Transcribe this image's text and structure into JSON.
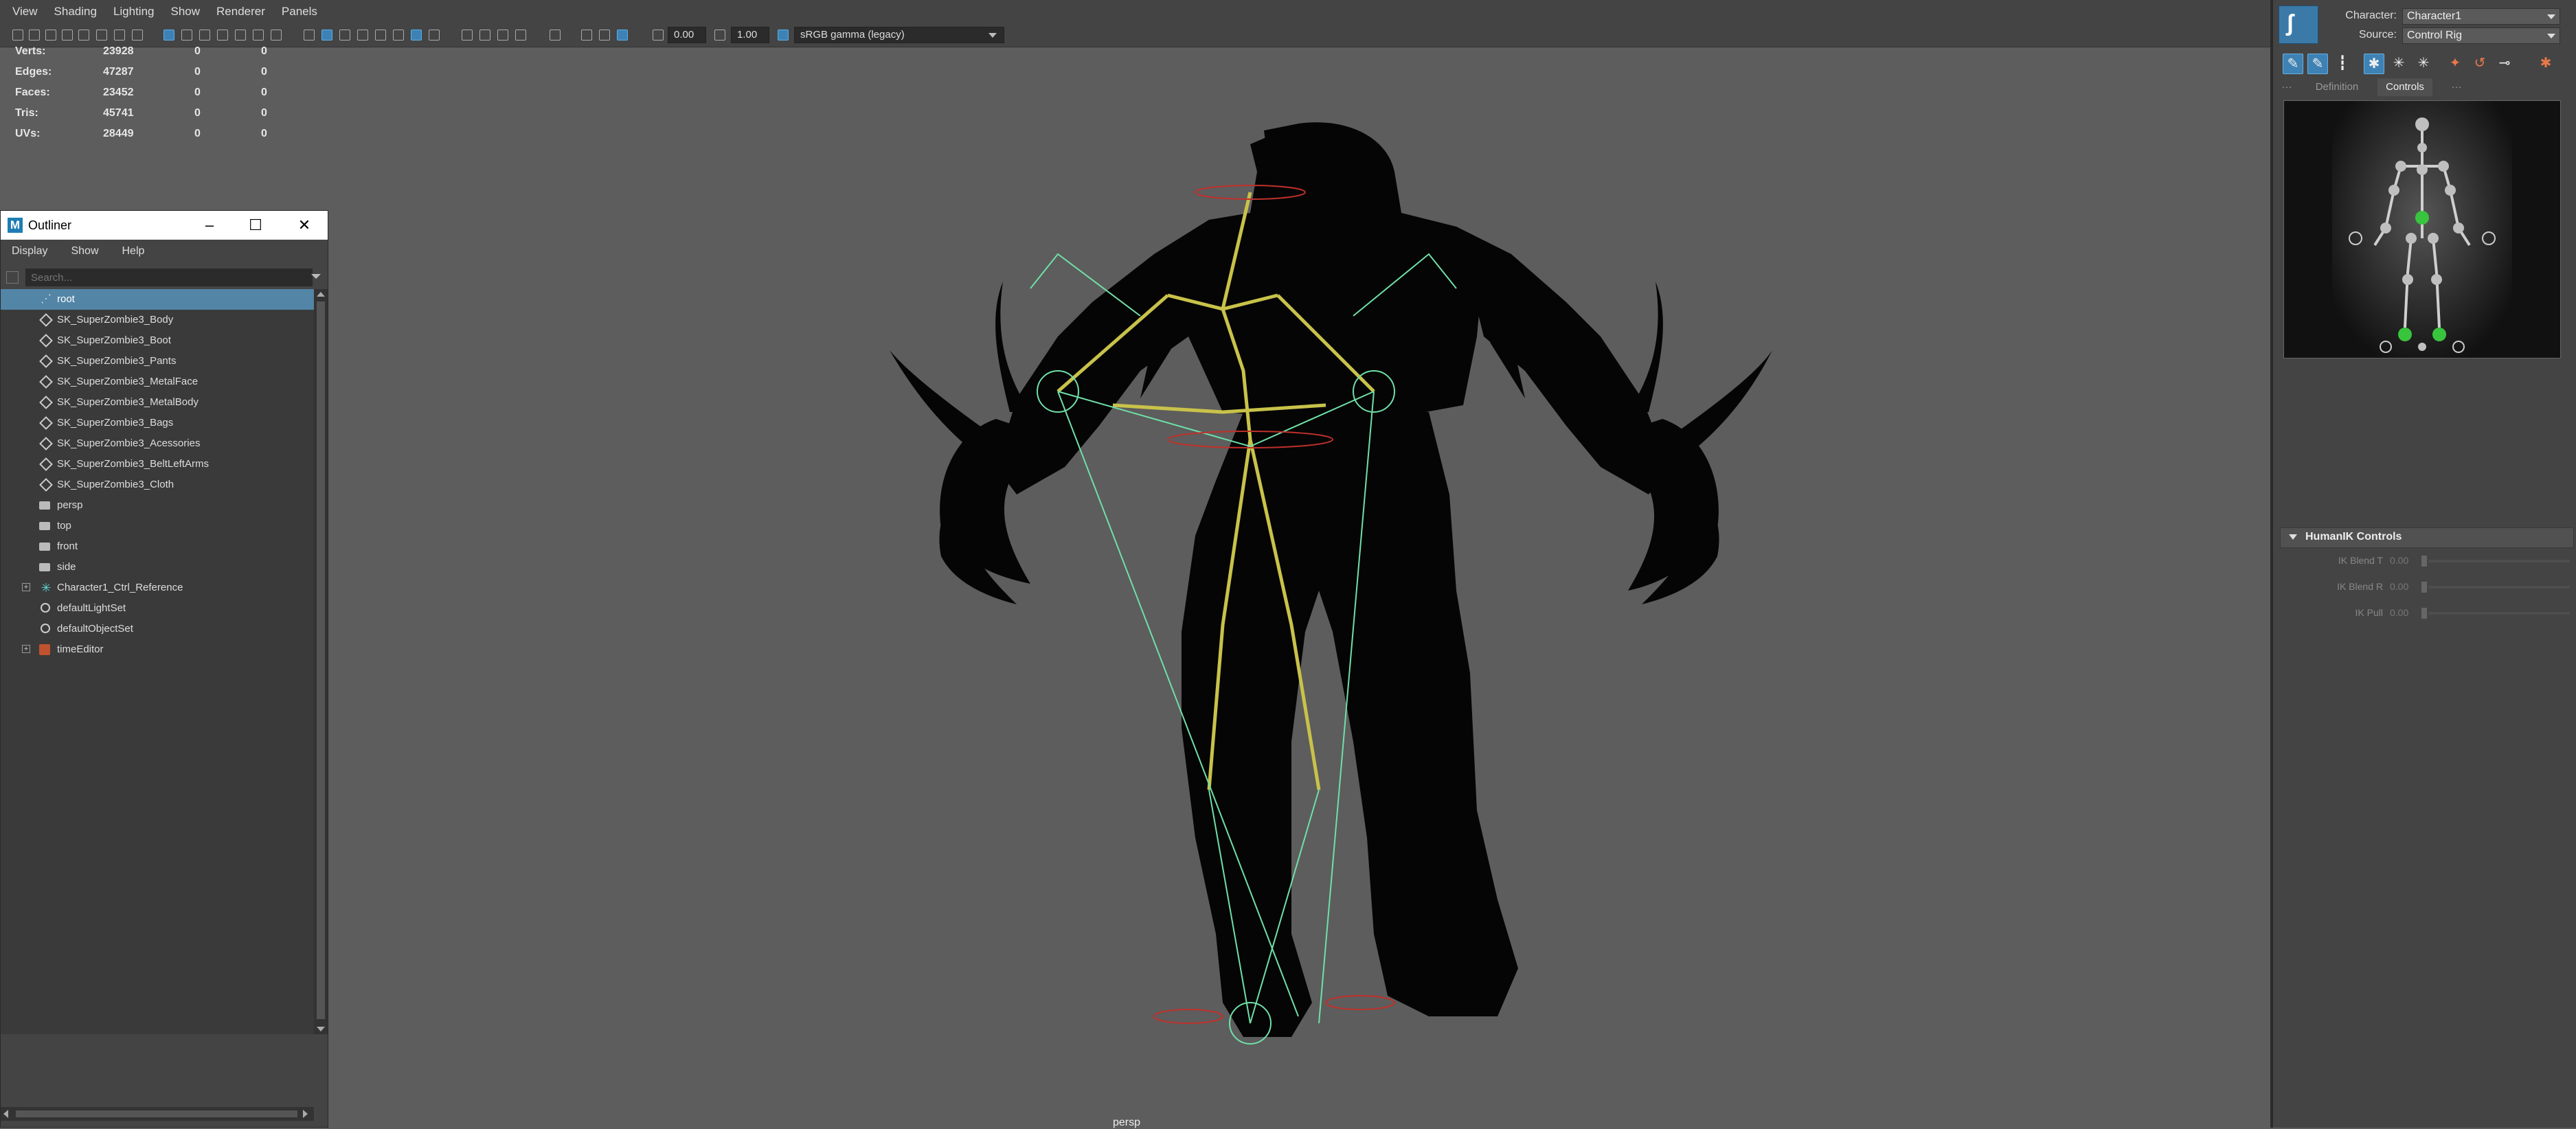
{
  "menu": [
    "View",
    "Shading",
    "Lighting",
    "Show",
    "Renderer",
    "Panels"
  ],
  "toolbar": {
    "exposure": "0.00",
    "gamma": "1.00",
    "color_space": "sRGB gamma (legacy)"
  },
  "hud": {
    "rows": [
      {
        "label": "Verts:",
        "v1": "23928",
        "v2": "0",
        "v3": "0"
      },
      {
        "label": "Edges:",
        "v1": "47287",
        "v2": "0",
        "v3": "0"
      },
      {
        "label": "Faces:",
        "v1": "23452",
        "v2": "0",
        "v3": "0"
      },
      {
        "label": "Tris:",
        "v1": "45741",
        "v2": "0",
        "v3": "0"
      },
      {
        "label": "UVs:",
        "v1": "28449",
        "v2": "0",
        "v3": "0"
      }
    ]
  },
  "camera_label": "persp",
  "outliner": {
    "title": "Outliner",
    "menu": [
      "Display",
      "Show",
      "Help"
    ],
    "search_placeholder": "Search...",
    "items": [
      {
        "label": "root",
        "icon": "joint",
        "selected": true,
        "expandable": false
      },
      {
        "label": "SK_SuperZombie3_Body",
        "icon": "mesh"
      },
      {
        "label": "SK_SuperZombie3_Boot",
        "icon": "mesh"
      },
      {
        "label": "SK_SuperZombie3_Pants",
        "icon": "mesh"
      },
      {
        "label": "SK_SuperZombie3_MetalFace",
        "icon": "mesh"
      },
      {
        "label": "SK_SuperZombie3_MetalBody",
        "icon": "mesh"
      },
      {
        "label": "SK_SuperZombie3_Bags",
        "icon": "mesh"
      },
      {
        "label": "SK_SuperZombie3_Acessories",
        "icon": "mesh"
      },
      {
        "label": "SK_SuperZombie3_BeltLeftArms",
        "icon": "mesh"
      },
      {
        "label": "SK_SuperZombie3_Cloth",
        "icon": "mesh"
      },
      {
        "label": "persp",
        "icon": "camera"
      },
      {
        "label": "top",
        "icon": "camera"
      },
      {
        "label": "front",
        "icon": "camera"
      },
      {
        "label": "side",
        "icon": "camera"
      },
      {
        "label": "Character1_Ctrl_Reference",
        "icon": "control",
        "expandable": true
      },
      {
        "label": "defaultLightSet",
        "icon": "set"
      },
      {
        "label": "defaultObjectSet",
        "icon": "set"
      },
      {
        "label": "timeEditor",
        "icon": "time",
        "expandable": true
      }
    ]
  },
  "hik": {
    "character_label": "Character:",
    "character_value": "Character1",
    "source_label": "Source:",
    "source_value": "Control Rig",
    "tabs": [
      "Definition",
      "Controls"
    ],
    "active_tab": "Controls",
    "controls_header": "HumanIK Controls",
    "ik_rows": [
      {
        "label": "IK Blend T",
        "value": "0.00"
      },
      {
        "label": "IK Blend R",
        "value": "0.00"
      },
      {
        "label": "IK Pull",
        "value": "0.00"
      }
    ]
  },
  "colors": {
    "viewport_bg": "#5d5d5d",
    "selection": "#5285a6",
    "skeleton_yellow": "#c8c24a",
    "control_green": "#6fe0a8"
  }
}
